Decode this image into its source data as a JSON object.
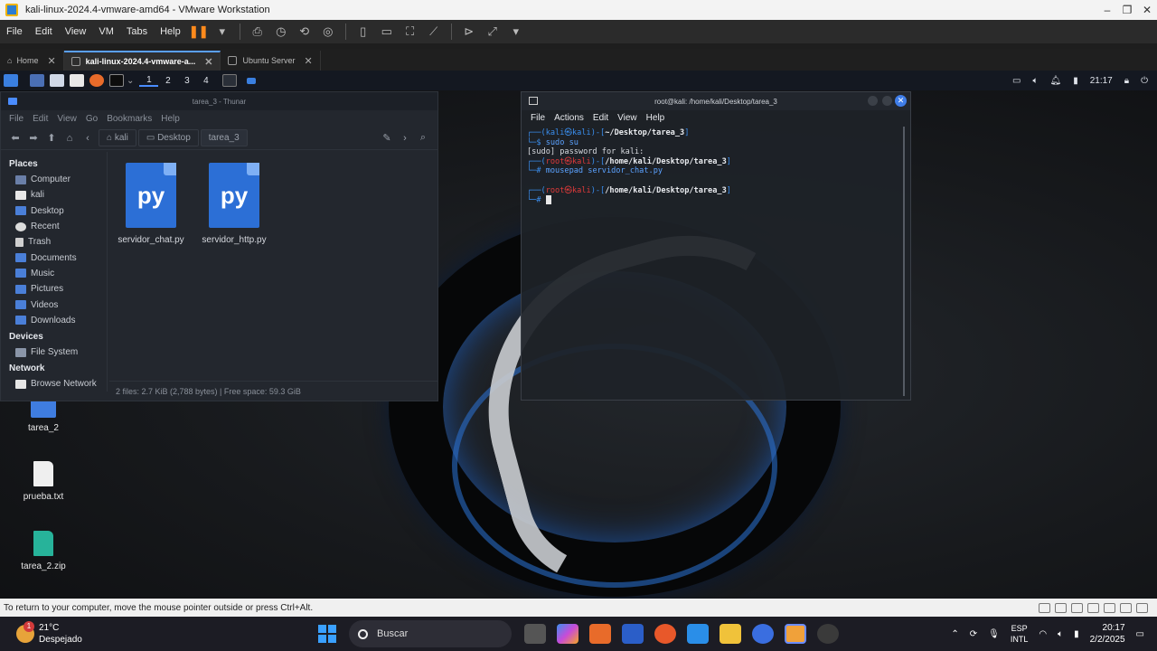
{
  "vmware": {
    "window_title": "kali-linux-2024.4-vmware-amd64 - VMware Workstation",
    "menu": [
      "File",
      "Edit",
      "View",
      "VM",
      "Tabs",
      "Help"
    ],
    "tabs": [
      {
        "label": "Home"
      },
      {
        "label": "kali-linux-2024.4-vmware-a..."
      },
      {
        "label": "Ubuntu Server"
      }
    ],
    "hint": "To return to your computer, move the mouse pointer outside or press Ctrl+Alt."
  },
  "kali_panel": {
    "workspaces": [
      "1",
      "2",
      "3",
      "4"
    ],
    "clock": "21:17"
  },
  "desktop_icons": [
    {
      "label": "tarea_2"
    },
    {
      "label": "prueba.txt"
    },
    {
      "label": "tarea_2.zip"
    }
  ],
  "thunar": {
    "title": "tarea_3 - Thunar",
    "menu": [
      "File",
      "Edit",
      "View",
      "Go",
      "Bookmarks",
      "Help"
    ],
    "breadcrumbs": [
      "kali",
      "Desktop",
      "tarea_3"
    ],
    "places_header": "Places",
    "places": [
      "Computer",
      "kali",
      "Desktop",
      "Recent",
      "Trash",
      "Documents",
      "Music",
      "Pictures",
      "Videos",
      "Downloads"
    ],
    "devices_header": "Devices",
    "devices": [
      "File System"
    ],
    "network_header": "Network",
    "network": [
      "Browse Network"
    ],
    "files": [
      {
        "name": "servidor_chat.py",
        "logo": "py"
      },
      {
        "name": "servidor_http.py",
        "logo": "py"
      }
    ],
    "status": "2 files: 2.7 KiB (2,788 bytes) | Free space: 59.3 GiB"
  },
  "terminal": {
    "title": "root@kali: /home/kali/Desktop/tarea_3",
    "menu": [
      "File",
      "Actions",
      "Edit",
      "View",
      "Help"
    ],
    "lines": {
      "p1_prefix": "┌──(",
      "p1_user": "kali㉿kali",
      "p1_mid": ")-[",
      "p1_path": "~/Desktop/tarea_3",
      "p1_end": "]",
      "p1_cmd_prefix": "└─$ ",
      "p1_cmd": "sudo su",
      "sudo_prompt": "[sudo] password for kali:",
      "p2_prefix": "┌──(",
      "p2_user": "root㉿kali",
      "p2_mid": ")-[",
      "p2_path": "/home/kali/Desktop/tarea_3",
      "p2_end": "]",
      "p2_cmd_prefix": "└─# ",
      "p2_cmd": "mousepad servidor_chat.py",
      "p3_prefix": "┌──(",
      "p3_user": "root㉿kali",
      "p3_mid": ")-[",
      "p3_path": "/home/kali/Desktop/tarea_3",
      "p3_end": "]",
      "p3_cmd_prefix": "└─# "
    }
  },
  "taskbar": {
    "weather_temp": "21°C",
    "weather_desc": "Despejado",
    "search_placeholder": "Buscar",
    "lang_top": "ESP",
    "lang_bottom": "INTL",
    "time": "20:17",
    "date": "2/2/2025"
  },
  "colors": {
    "accent_blue": "#4a8cff",
    "root_red": "#e03a3a",
    "pause_orange": "#ff8a1c"
  }
}
